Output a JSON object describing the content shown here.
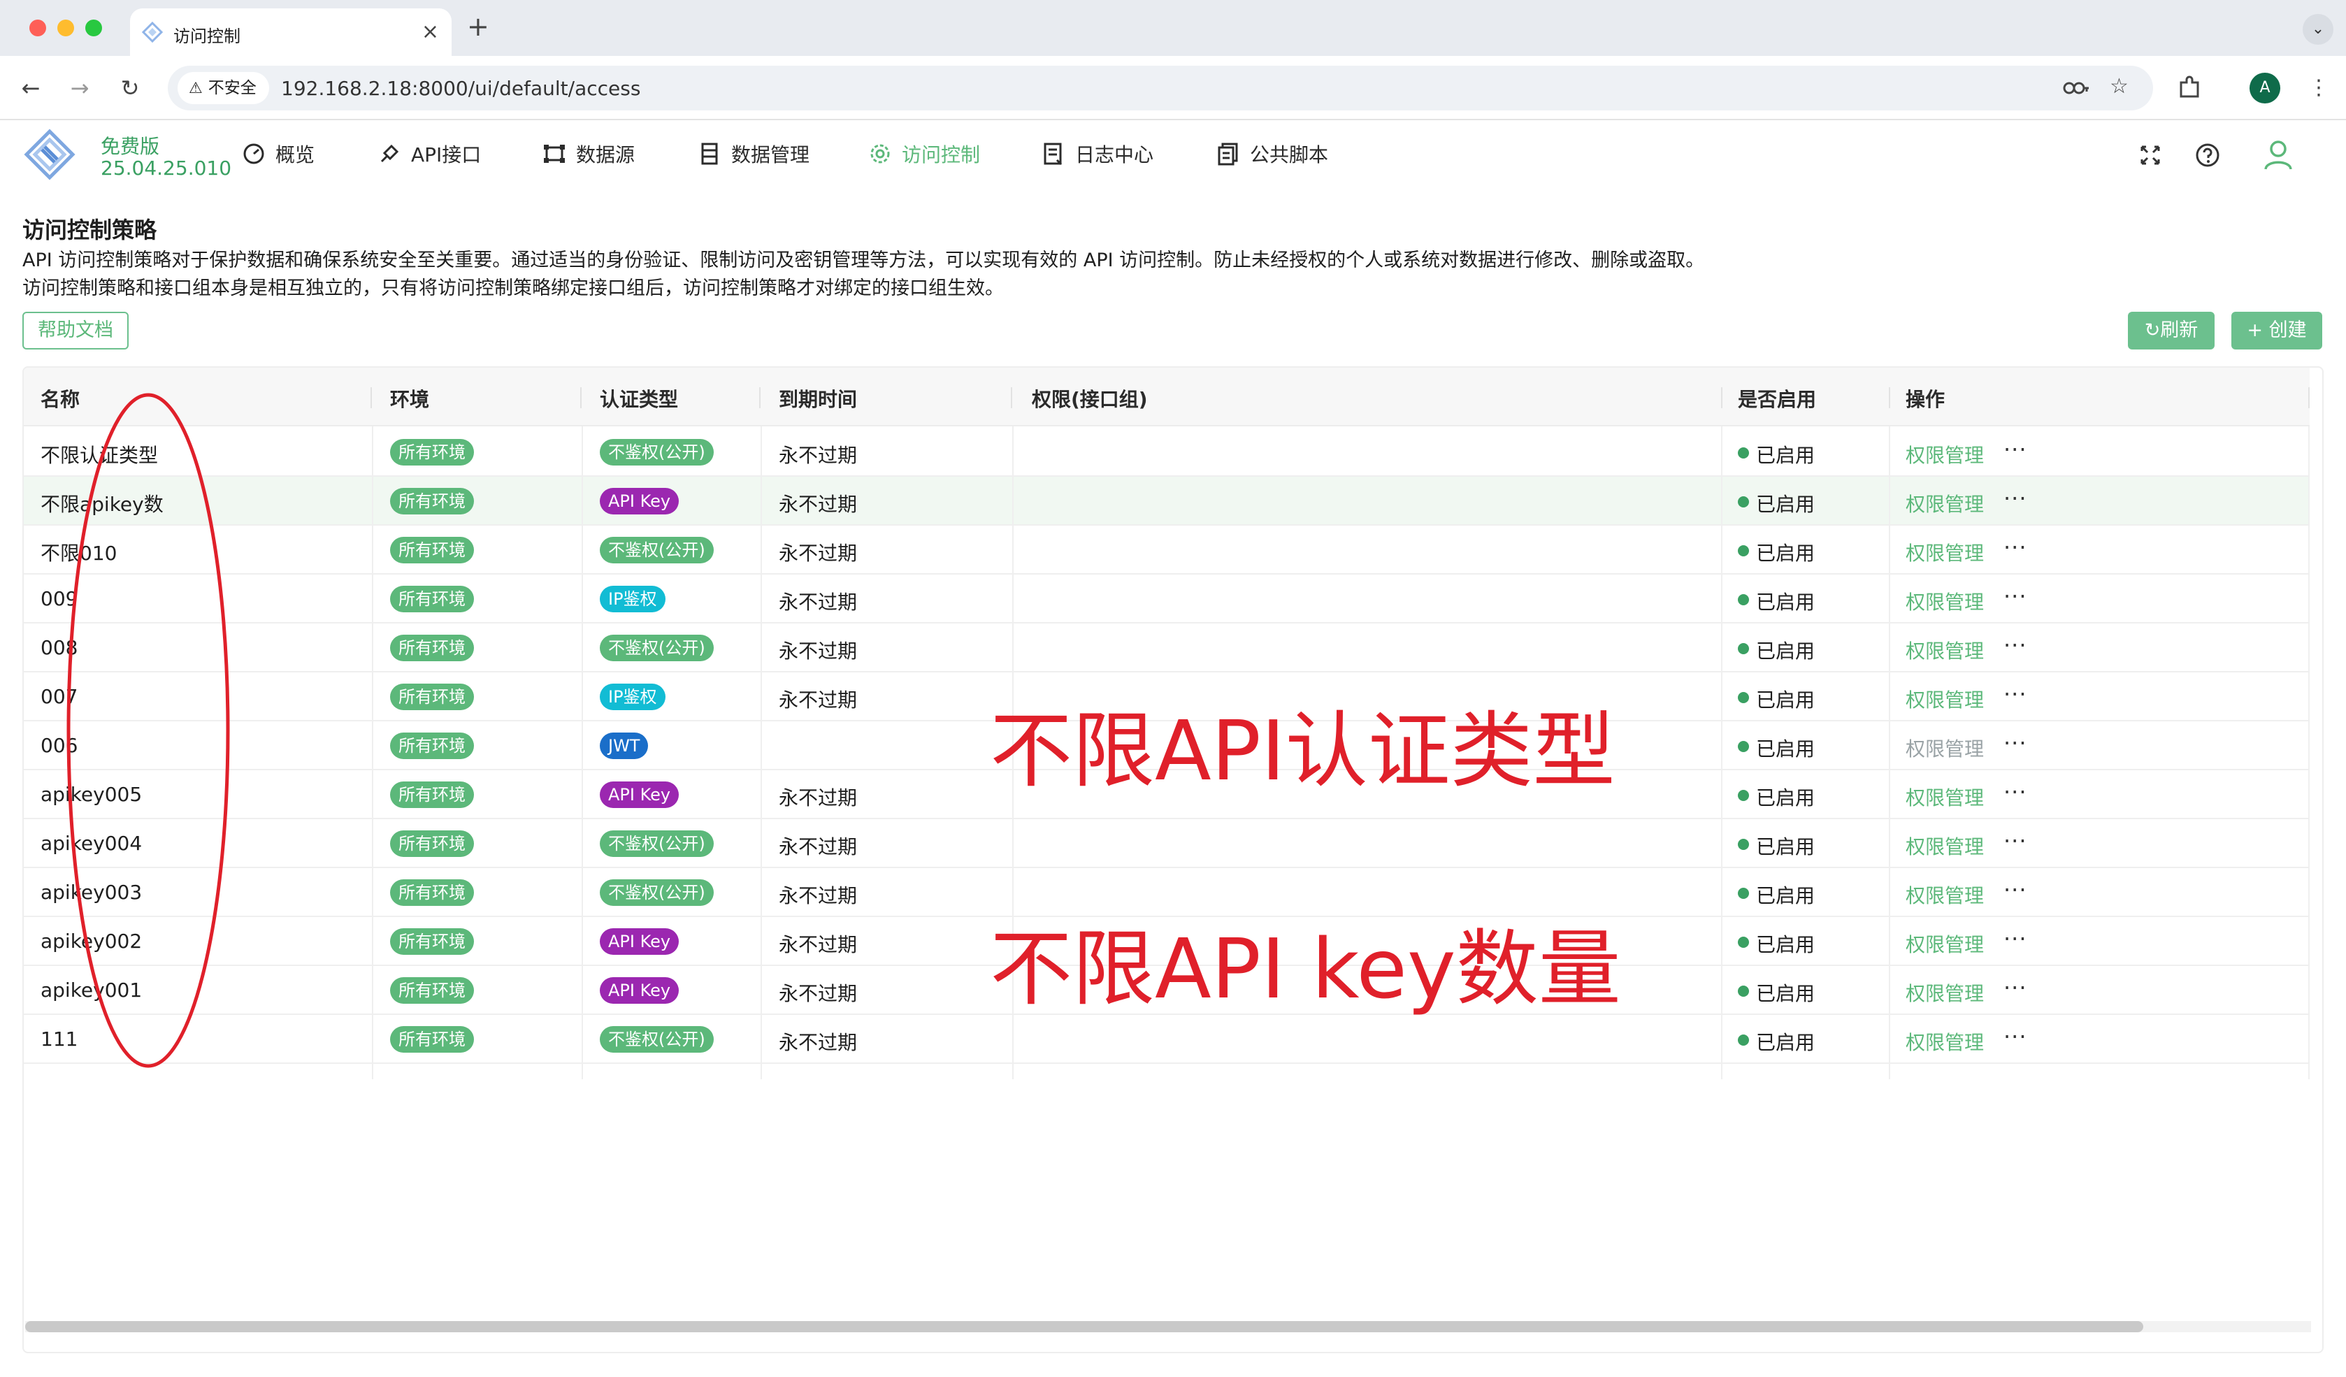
{
  "browser": {
    "tab_title": "访问控制",
    "security_label": "不安全",
    "url": "192.168.2.18:8000/ui/default/access",
    "profile_initial": "A"
  },
  "app": {
    "edition": "免费版",
    "version": "25.04.25.010",
    "nav": [
      {
        "label": "概览",
        "icon": "dashboard-icon"
      },
      {
        "label": "API接口",
        "icon": "api-plug-icon"
      },
      {
        "label": "数据源",
        "icon": "datasource-icon"
      },
      {
        "label": "数据管理",
        "icon": "data-manage-icon"
      },
      {
        "label": "访问控制",
        "icon": "gear-icon",
        "active": true
      },
      {
        "label": "日志中心",
        "icon": "log-icon"
      },
      {
        "label": "公共脚本",
        "icon": "script-icon"
      }
    ],
    "accent_color": "#5cb87a"
  },
  "page": {
    "title": "访问控制策略",
    "desc_line1": "API 访问控制策略对于保护数据和确保系统安全至关重要。通过适当的身份验证、限制访问及密钥管理等方法，可以实现有效的 API 访问控制。防止未经授权的个人或系统对数据进行修改、删除或盗取。",
    "desc_line2": "访问控制策略和接口组本身是相互独立的，只有将访问控制策略绑定接口组后，访问控制策略才对绑定的接口组生效。",
    "help_label": "帮助文档",
    "refresh_label": "↻刷新",
    "create_label": "+ 创建"
  },
  "table": {
    "headers": {
      "name": "名称",
      "env": "环境",
      "auth": "认证类型",
      "expire": "到期时间",
      "perm": "权限(接口组)",
      "enabled": "是否启用",
      "ops": "操作"
    },
    "rows": [
      {
        "name": "不限认证类型",
        "env": "所有环境",
        "auth": "不鉴权(公开)",
        "auth_kind": "none",
        "expire": "永不过期",
        "enabled": "已启用",
        "op": "权限管理",
        "more": "···"
      },
      {
        "name": "不限apikey数",
        "env": "所有环境",
        "auth": "API Key",
        "auth_kind": "apikey",
        "expire": "永不过期",
        "enabled": "已启用",
        "op": "权限管理",
        "more": "···"
      },
      {
        "name": "不限010",
        "env": "所有环境",
        "auth": "不鉴权(公开)",
        "auth_kind": "none",
        "expire": "永不过期",
        "enabled": "已启用",
        "op": "权限管理",
        "more": "···"
      },
      {
        "name": "009",
        "env": "所有环境",
        "auth": "IP鉴权",
        "auth_kind": "ip",
        "expire": "永不过期",
        "enabled": "已启用",
        "op": "权限管理",
        "more": "···"
      },
      {
        "name": "008",
        "env": "所有环境",
        "auth": "不鉴权(公开)",
        "auth_kind": "none",
        "expire": "永不过期",
        "enabled": "已启用",
        "op": "权限管理",
        "more": "···"
      },
      {
        "name": "007",
        "env": "所有环境",
        "auth": "IP鉴权",
        "auth_kind": "ip",
        "expire": "永不过期",
        "enabled": "已启用",
        "op": "权限管理",
        "more": "···"
      },
      {
        "name": "006",
        "env": "所有环境",
        "auth": "JWT",
        "auth_kind": "jwt",
        "expire": "",
        "enabled": "已启用",
        "op": "权限管理",
        "more": "···"
      },
      {
        "name": "apikey005",
        "env": "所有环境",
        "auth": "API Key",
        "auth_kind": "apikey",
        "expire": "永不过期",
        "enabled": "已启用",
        "op": "权限管理",
        "more": "···"
      },
      {
        "name": "apikey004",
        "env": "所有环境",
        "auth": "不鉴权(公开)",
        "auth_kind": "none",
        "expire": "永不过期",
        "enabled": "已启用",
        "op": "权限管理",
        "more": "···"
      },
      {
        "name": "apikey003",
        "env": "所有环境",
        "auth": "不鉴权(公开)",
        "auth_kind": "none",
        "expire": "永不过期",
        "enabled": "已启用",
        "op": "权限管理",
        "more": "···"
      },
      {
        "name": "apikey002",
        "env": "所有环境",
        "auth": "API Key",
        "auth_kind": "apikey",
        "expire": "永不过期",
        "enabled": "已启用",
        "op": "权限管理",
        "more": "···"
      },
      {
        "name": "apikey001",
        "env": "所有环境",
        "auth": "API Key",
        "auth_kind": "apikey",
        "expire": "永不过期",
        "enabled": "已启用",
        "op": "权限管理",
        "more": "···"
      },
      {
        "name": "111",
        "env": "所有环境",
        "auth": "不鉴权(公开)",
        "auth_kind": "none",
        "expire": "永不过期",
        "enabled": "已启用",
        "op": "权限管理",
        "more": "···"
      }
    ]
  },
  "annotations": {
    "text1": "不限API认证类型",
    "text2": "不限API key数量",
    "color": "#e0202a"
  }
}
